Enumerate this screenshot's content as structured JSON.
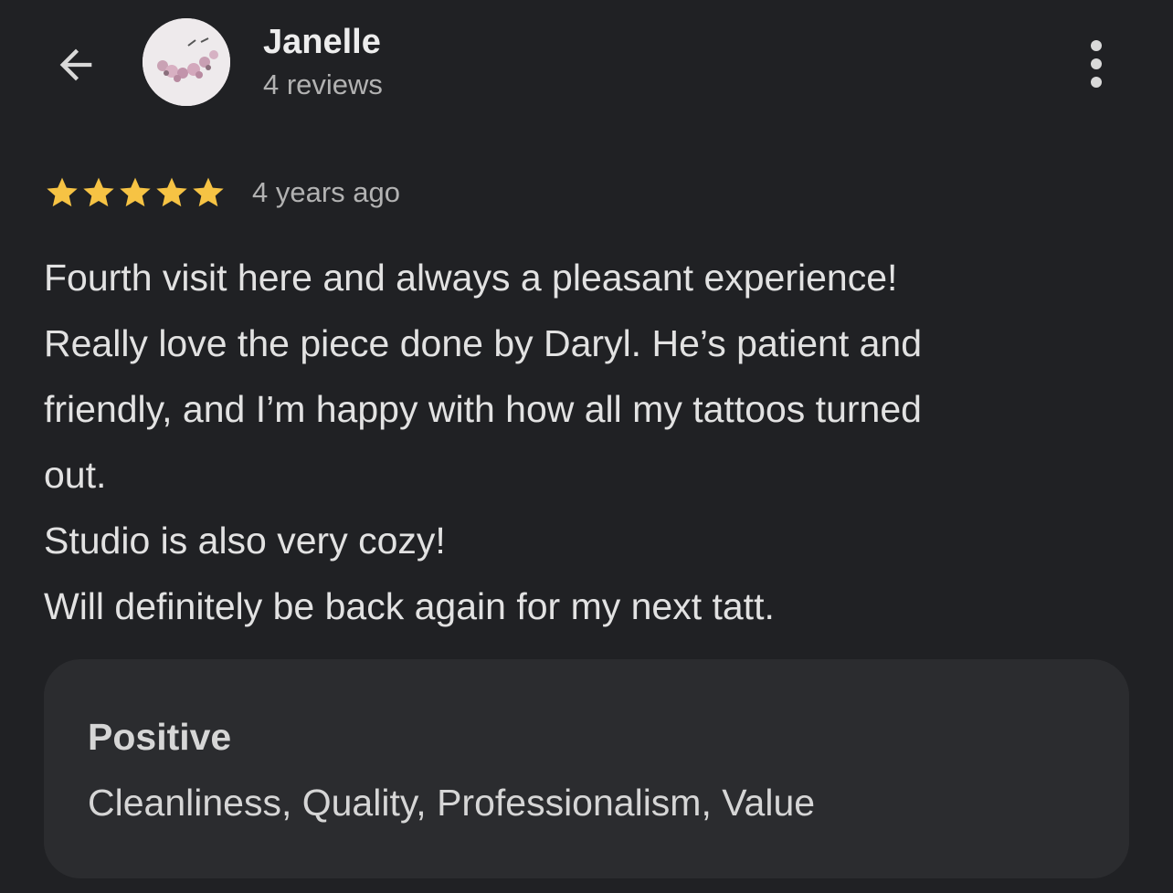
{
  "header": {
    "back_icon": "arrow-back-icon",
    "reviewer_name": "Janelle",
    "review_count": "4 reviews",
    "more_icon": "more-vert-icon"
  },
  "review": {
    "rating": 5,
    "rating_max": 5,
    "star_color": "#f6c344",
    "date": "4 years ago",
    "lines": [
      "Fourth visit here and always a pleasant experience!",
      "Really love the piece done by Daryl. He’s patient and",
      "friendly, and I’m happy with how all my tattoos turned",
      "out.",
      "Studio is also very cozy!",
      "Will definitely be back again for my next tatt."
    ]
  },
  "attributes": {
    "heading": "Positive",
    "values": "Cleanliness, Quality, Professionalism, Value"
  },
  "colors": {
    "background": "#202124",
    "card": "#2b2c2f",
    "primary_text": "#e3e3e3",
    "secondary_text": "#b2b2b2"
  }
}
